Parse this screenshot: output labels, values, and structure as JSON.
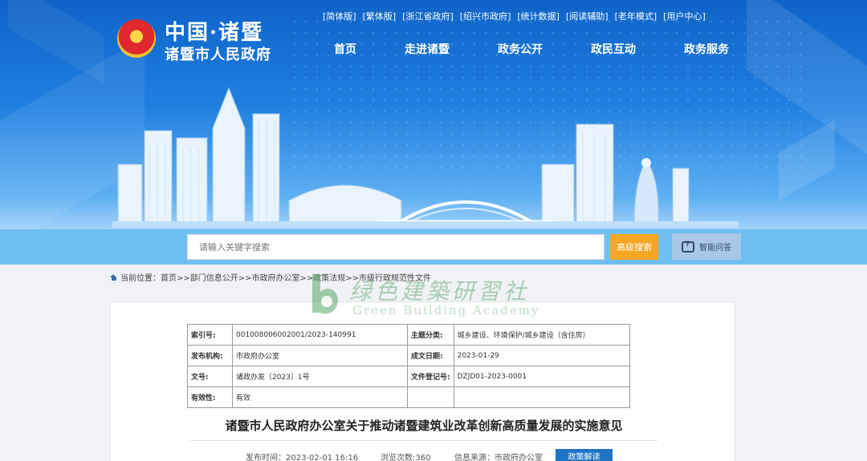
{
  "header": {
    "logo_title": "中国·诸暨",
    "logo_subtitle": "诸暨市人民政府",
    "top_links": [
      "[简体版]",
      "[繁体版]",
      "[浙江省政府]",
      "[绍兴市政府]",
      "[统计数据]",
      "[阅读辅助]",
      "[老年模式]",
      "[用户中心]"
    ],
    "nav": [
      "首页",
      "走进诸暨",
      "政务公开",
      "政民互动",
      "政务服务"
    ]
  },
  "search": {
    "placeholder": "请输入关键字搜索",
    "advanced_label": "高级搜索",
    "smart_qa_label": "智能问答"
  },
  "breadcrumb": "当前位置：首页>>部门信息公开>>市政府办公室>>政策法规>>市级行政规范性文件",
  "watermark": {
    "cn": "绿色建築研習社",
    "en": "Green Building Academy"
  },
  "meta_table": {
    "rows": [
      {
        "k1": "索引号:",
        "v1": "001008006002001/2023-140991",
        "k2": "主题分类:",
        "v2": "城乡建设、环境保护/城乡建设（含住房）"
      },
      {
        "k1": "发布机构:",
        "v1": "市政府办公室",
        "k2": "成文日期:",
        "v2": "2023-01-29"
      },
      {
        "k1": "文号:",
        "v1": "诸政办发〔2023〕1号",
        "k2": "文件登记号:",
        "v2": "DZJD01-2023-0001"
      },
      {
        "k1": "有效性:",
        "v1": "有效",
        "k2": "",
        "v2": ""
      }
    ]
  },
  "document": {
    "title": "诸暨市人民政府办公室关于推动诸暨建筑业改革创新高质量发展的实施意见",
    "publish_time": "发布时间：2023-02-01 16:16",
    "views": "浏览次数:360",
    "source": "信息来源：市政府办公室",
    "policy_button": "政策解读"
  },
  "colors": {
    "banner_top": "#0f63c8",
    "search_band": "#6fbff2",
    "advanced_button": "#f5a623",
    "policy_button": "#1f74c6"
  }
}
